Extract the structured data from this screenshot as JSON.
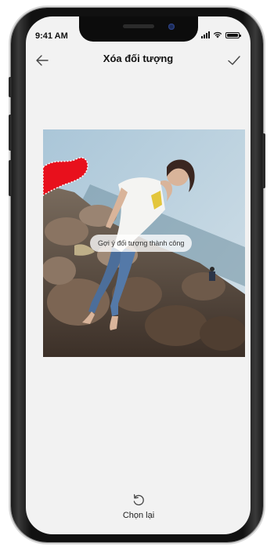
{
  "status_bar": {
    "time": "9:41 AM"
  },
  "header": {
    "title": "Xóa đối tượng"
  },
  "toast": {
    "text": "Gợi ý đối tượng thành công"
  },
  "footer": {
    "reset_label": "Chọn lại"
  },
  "colors": {
    "screen_bg": "#f2f2f2",
    "highlight": "#e8101c"
  },
  "icons": {
    "back": "arrow-left-icon",
    "confirm": "checkmark-icon",
    "reset": "rotate-ccw-icon"
  }
}
